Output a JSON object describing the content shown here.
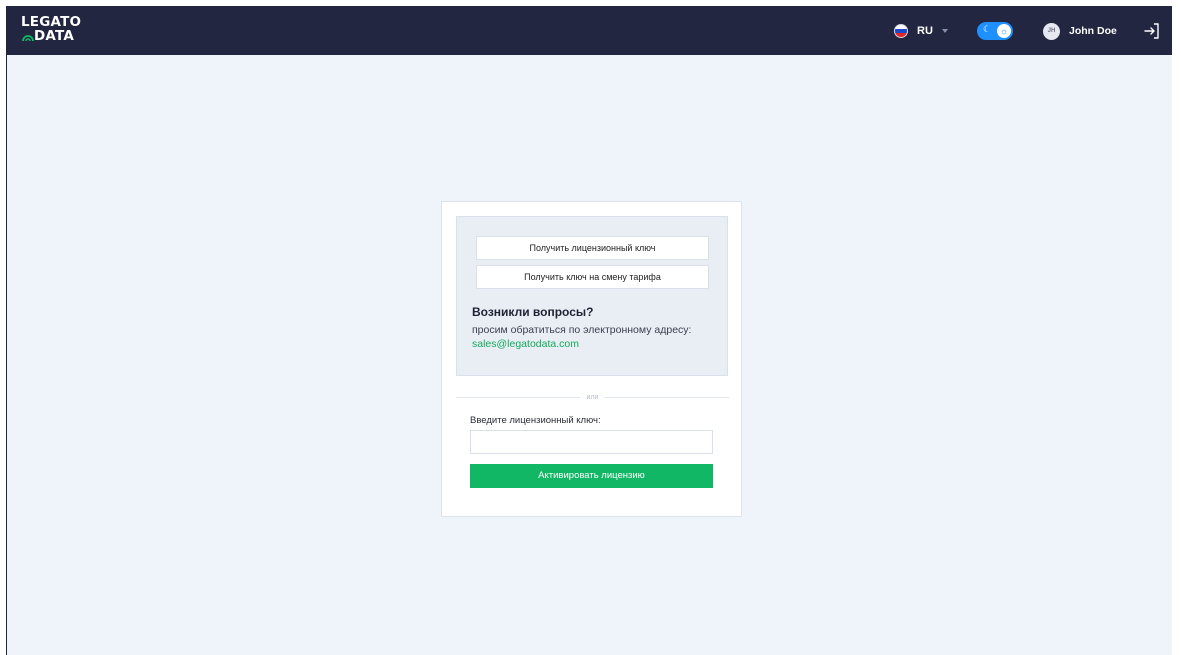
{
  "header": {
    "logo": {
      "line1": "LEGATO",
      "line2": "DATA"
    },
    "language": {
      "label": "RU",
      "flag_icon": "russia-flag-icon"
    },
    "theme_toggle": {
      "state": "dark",
      "moon_icon": "moon-icon",
      "sun_icon": "sun-icon"
    },
    "user": {
      "initials": "JH",
      "name": "John Doe"
    },
    "logout_icon": "logout-icon"
  },
  "license": {
    "get_key_label": "Получить лицензионный ключ",
    "get_tariff_key_label": "Получить ключ на смену тарифа",
    "questions_title": "Возникли вопросы?",
    "questions_text": "просим обратиться по электронному адресу: ",
    "email": "sales@legatodata.com",
    "divider_text": "или",
    "key_label": "Введите лицензионный ключ:",
    "key_value": "",
    "activate_label": "Активировать лицензию"
  },
  "colors": {
    "header_bg": "#222641",
    "page_bg": "#eff4fa",
    "accent_green": "#12b765",
    "toggle_blue": "#1e90ff",
    "link_green": "#12a85a"
  }
}
